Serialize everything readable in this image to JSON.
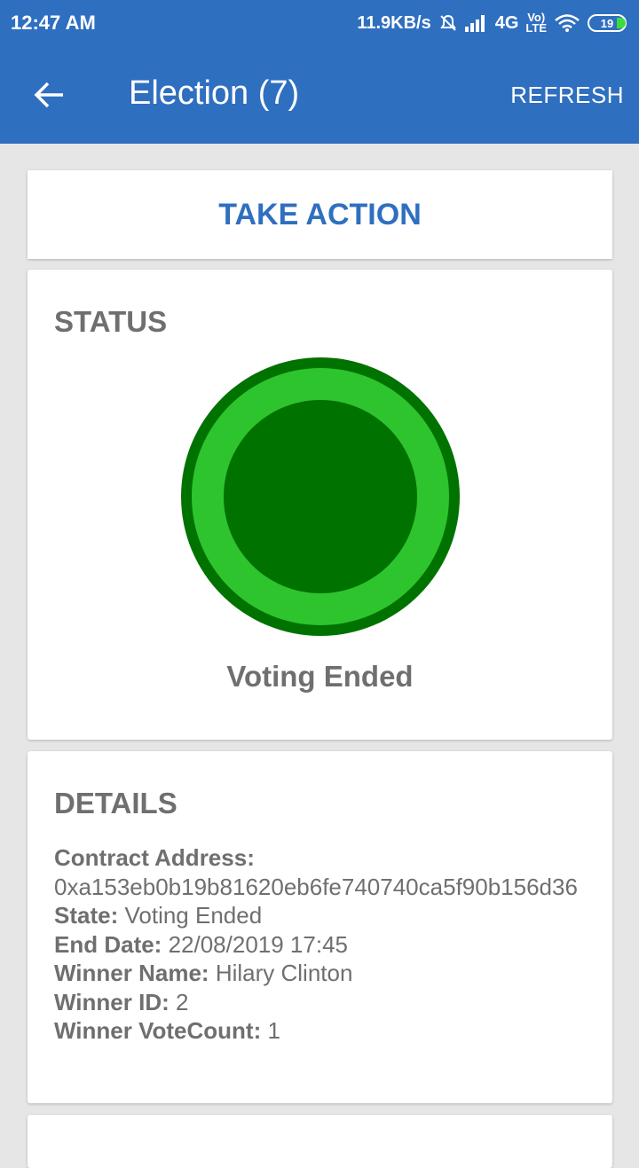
{
  "status_bar": {
    "time": "12:47 AM",
    "speed": "11.9KB/s",
    "network": "4G",
    "volte_top": "Vo)",
    "volte_bottom": "LTE",
    "battery": "19"
  },
  "app_bar": {
    "title": "Election (7)",
    "action": "REFRESH"
  },
  "take_action": {
    "label": "TAKE ACTION"
  },
  "status": {
    "title": "STATUS",
    "label": "Voting Ended",
    "colors": {
      "outer": "#007200",
      "mid": "#2ec42e",
      "inner": "#007200"
    }
  },
  "details": {
    "title": "DETAILS",
    "contract_address_label": "Contract Address:",
    "contract_address": "0xa153eb0b19b81620eb6fe740740ca5f90b156d36",
    "state_label": "State:",
    "state": "Voting Ended",
    "end_date_label": "End Date:",
    "end_date": "22/08/2019 17:45",
    "winner_name_label": "Winner Name:",
    "winner_name": "Hilary Clinton",
    "winner_id_label": "Winner ID:",
    "winner_id": "2",
    "winner_votecount_label": "Winner VoteCount:",
    "winner_votecount": "1"
  },
  "colors": {
    "primary": "#2f6fc0",
    "background": "#e6e6e6",
    "text": "#6f6f6f"
  }
}
